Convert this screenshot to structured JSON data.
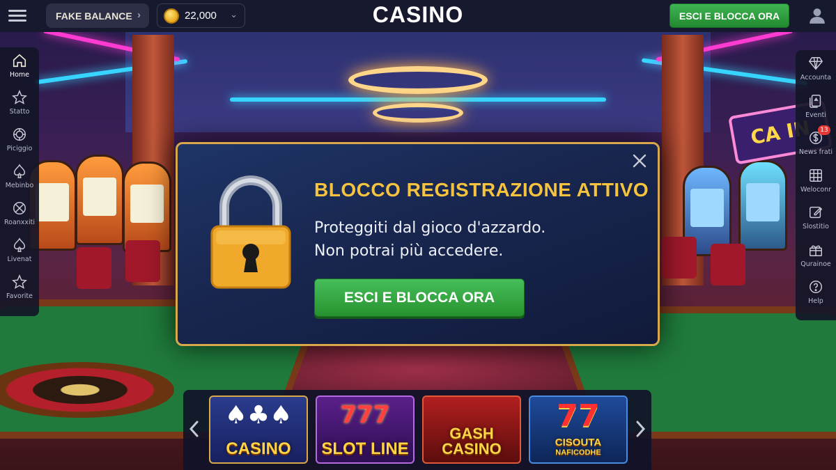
{
  "header": {
    "fake_balance_label": "FAKE BALANCE",
    "coin_balance": "22,000",
    "brand": "CASINO",
    "cta_label": "ESCI E BLOCCA ORA"
  },
  "left_nav": [
    {
      "label": "Home",
      "icon": "home-icon"
    },
    {
      "label": "Statto",
      "icon": "star-icon"
    },
    {
      "label": "Piciggio",
      "icon": "chip-icon"
    },
    {
      "label": "Mebinbo",
      "icon": "spade-icon"
    },
    {
      "label": "Roanxxiti",
      "icon": "no-entry-icon"
    },
    {
      "label": "Livenat",
      "icon": "spade-icon"
    },
    {
      "label": "Favorite",
      "icon": "star-icon"
    }
  ],
  "right_nav": [
    {
      "label": "Accounta",
      "icon": "diamond-icon"
    },
    {
      "label": "Eventi",
      "icon": "cards-icon"
    },
    {
      "label": "News frati",
      "icon": "dollar-icon",
      "badge": "13"
    },
    {
      "label": "Weloconr",
      "icon": "grid-icon"
    },
    {
      "label": "Slostitio",
      "icon": "edit-icon"
    },
    {
      "label": "Qurainoe",
      "icon": "gift-icon"
    },
    {
      "label": "Help",
      "icon": "help-icon"
    }
  ],
  "modal": {
    "title": "BLOCCO REGISTRAZIONE ATTIVO",
    "line1": "Proteggiti dal gioco d'azzardo.",
    "line2": "Non potrai più accedere.",
    "cta_label": "ESCI E BLOCCA ORA"
  },
  "scene": {
    "sign_text": "CA IN"
  },
  "games": [
    {
      "title": "CASINO",
      "art": "♠♣♠"
    },
    {
      "title": "SLOT LINE",
      "art": "777"
    },
    {
      "title": "GASH",
      "title2": "CASINO"
    },
    {
      "title": "CISOUTA",
      "subtitle": "NAFICODHE",
      "art": "77"
    }
  ],
  "colors": {
    "accent_gold": "#f5c33d",
    "cta_green": "#3fb553",
    "modal_bg": "#18264f",
    "badge_red": "#e53935"
  }
}
